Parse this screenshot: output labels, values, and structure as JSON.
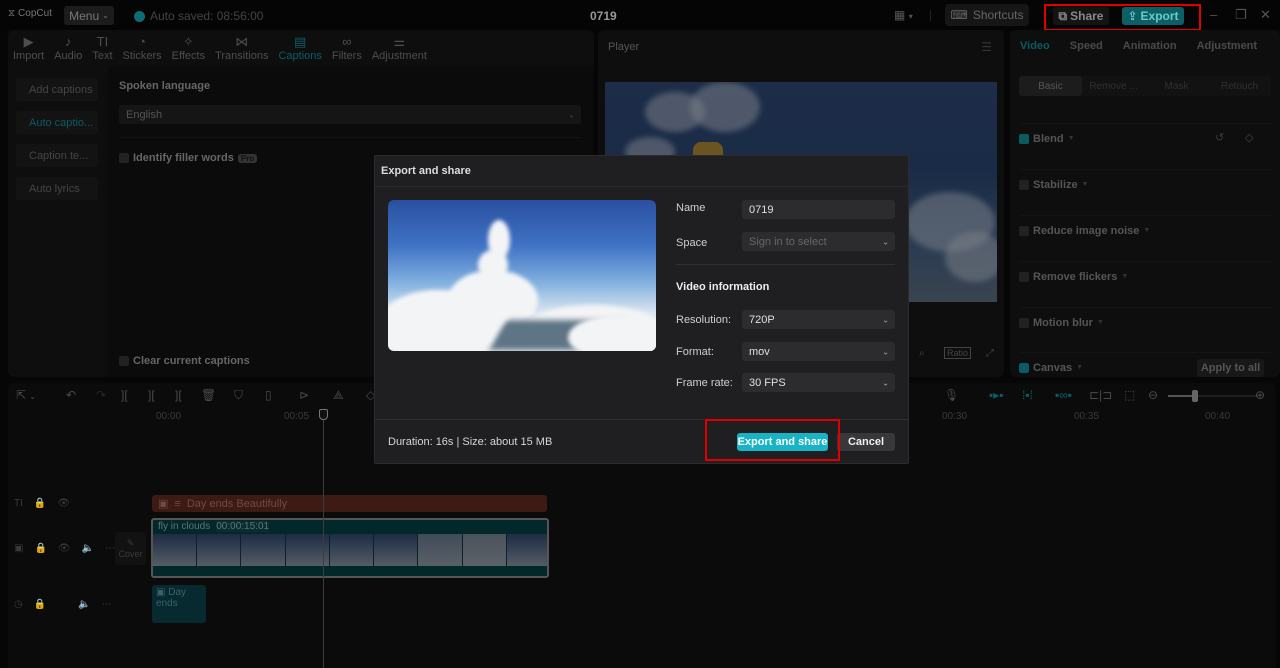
{
  "titlebar": {
    "logo": "CopCut",
    "menu_label": "Menu",
    "autosave": "Auto saved: 08:56:00",
    "project_title": "0719",
    "shortcuts_label": "Shortcuts",
    "share_label": "Share",
    "export_label": "Export"
  },
  "media_tabs": [
    {
      "label": "Import",
      "icon": "import-icon",
      "glyph": "▶"
    },
    {
      "label": "Audio",
      "icon": "audio-icon",
      "glyph": "♪"
    },
    {
      "label": "Text",
      "icon": "text-icon",
      "glyph": "TI"
    },
    {
      "label": "Stickers",
      "icon": "sticker-icon",
      "glyph": "◔"
    },
    {
      "label": "Effects",
      "icon": "effects-icon",
      "glyph": "✧"
    },
    {
      "label": "Transitions",
      "icon": "transitions-icon",
      "glyph": "⋈"
    },
    {
      "label": "Captions",
      "icon": "captions-icon",
      "glyph": "▤"
    },
    {
      "label": "Filters",
      "icon": "filters-icon",
      "glyph": "∞"
    },
    {
      "label": "Adjustment",
      "icon": "adjustment-icon",
      "glyph": "⚌"
    }
  ],
  "captions_sidebar": [
    {
      "label": "Add captions"
    },
    {
      "label": "Auto captio..."
    },
    {
      "label": "Caption te..."
    },
    {
      "label": "Auto lyrics"
    }
  ],
  "captions": {
    "spoken_language_label": "Spoken language",
    "language_value": "English",
    "filler_words_label": "Identify filler words",
    "pro_badge": "Pro",
    "clear_captions_label": "Clear current captions"
  },
  "player": {
    "title": "Player",
    "ratio_label": "Ratio"
  },
  "props": {
    "tabs": [
      "Video",
      "Speed",
      "Animation",
      "Adjustment"
    ],
    "subtabs": [
      "Basic",
      "Remove ...",
      "Mask",
      "Retouch"
    ],
    "rows": [
      {
        "label": "Blend",
        "checked": true
      },
      {
        "label": "Stabilize",
        "checked": false
      },
      {
        "label": "Reduce image noise",
        "checked": false
      },
      {
        "label": "Remove flickers",
        "checked": false
      },
      {
        "label": "Motion blur",
        "checked": false
      },
      {
        "label": "Canvas",
        "checked": true
      }
    ],
    "apply_all_label": "Apply to all"
  },
  "timeline": {
    "ruler_ticks": [
      "00:00",
      "00:05",
      "00:30",
      "00:35",
      "00:40"
    ],
    "text_clip": "Day ends Beautifully",
    "video_clip_name": "fly in clouds",
    "video_clip_duration": "00:00:15:01",
    "audio_clip": "Day ends",
    "cover_label": "Cover",
    "zoom_level": 0.3
  },
  "export_dialog": {
    "title": "Export and share",
    "name_label": "Name",
    "name_value": "0719",
    "space_label": "Space",
    "space_placeholder": "Sign in to select",
    "section_title": "Video information",
    "resolution_label": "Resolution:",
    "resolution_value": "720P",
    "format_label": "Format:",
    "format_value": "mov",
    "framerate_label": "Frame rate:",
    "framerate_value": "30 FPS",
    "info": "Duration: 16s | Size: about 15 MB",
    "primary_label": "Export and share",
    "cancel_label": "Cancel"
  },
  "colors": {
    "accent": "#18b3c4",
    "highlight_box": "#e00000"
  }
}
